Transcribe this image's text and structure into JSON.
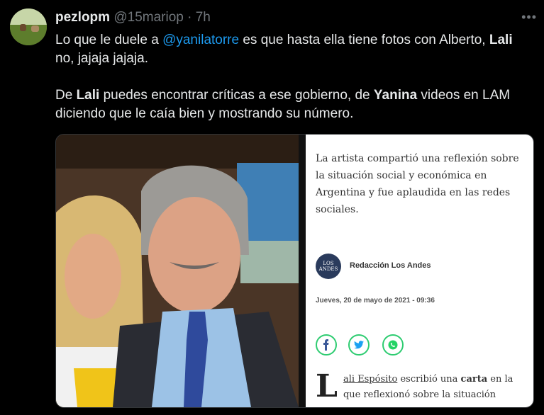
{
  "tweet": {
    "display_name": "pezlopm",
    "handle": "@15mariop",
    "separator": "·",
    "time": "7h",
    "more": "•••",
    "line1_before": "Lo que le duele a ",
    "mention": "@yanilatorre",
    "line1_after": " es que hasta ella tiene fotos con Alberto, ",
    "line1_bold": "Lali",
    "line1_end": " no, jajaja jajaja.",
    "p2_start": "De ",
    "p2_bold1": "Lali",
    "p2_mid": " puedes encontrar críticas a ese gobierno, de ",
    "p2_bold2": "Yanina",
    "p2_end": " videos en LAM diciendo que le caía bien y mostrando su número."
  },
  "article": {
    "lead": "La artista compartió una reflexión sobre la situación social y económica en Argentina y fue aplaudida en las redes sociales.",
    "logo_text": "LOS ANDES",
    "author": "Redacción Los Andes",
    "date": "Jueves, 20 de mayo de 2021 - 09:36",
    "share_icons": [
      "facebook-icon",
      "twitter-icon",
      "whatsapp-icon"
    ],
    "dropcap": "L",
    "body_link": "ali Espósito",
    "body_mid": " escribió una ",
    "body_bold": "carta",
    "body_end": " en la que reflexionó sobre la situación"
  },
  "colors": {
    "background": "#000000",
    "mention": "#1d9bf0",
    "muted": "#71767b",
    "share_ring": "#2ecc71"
  }
}
